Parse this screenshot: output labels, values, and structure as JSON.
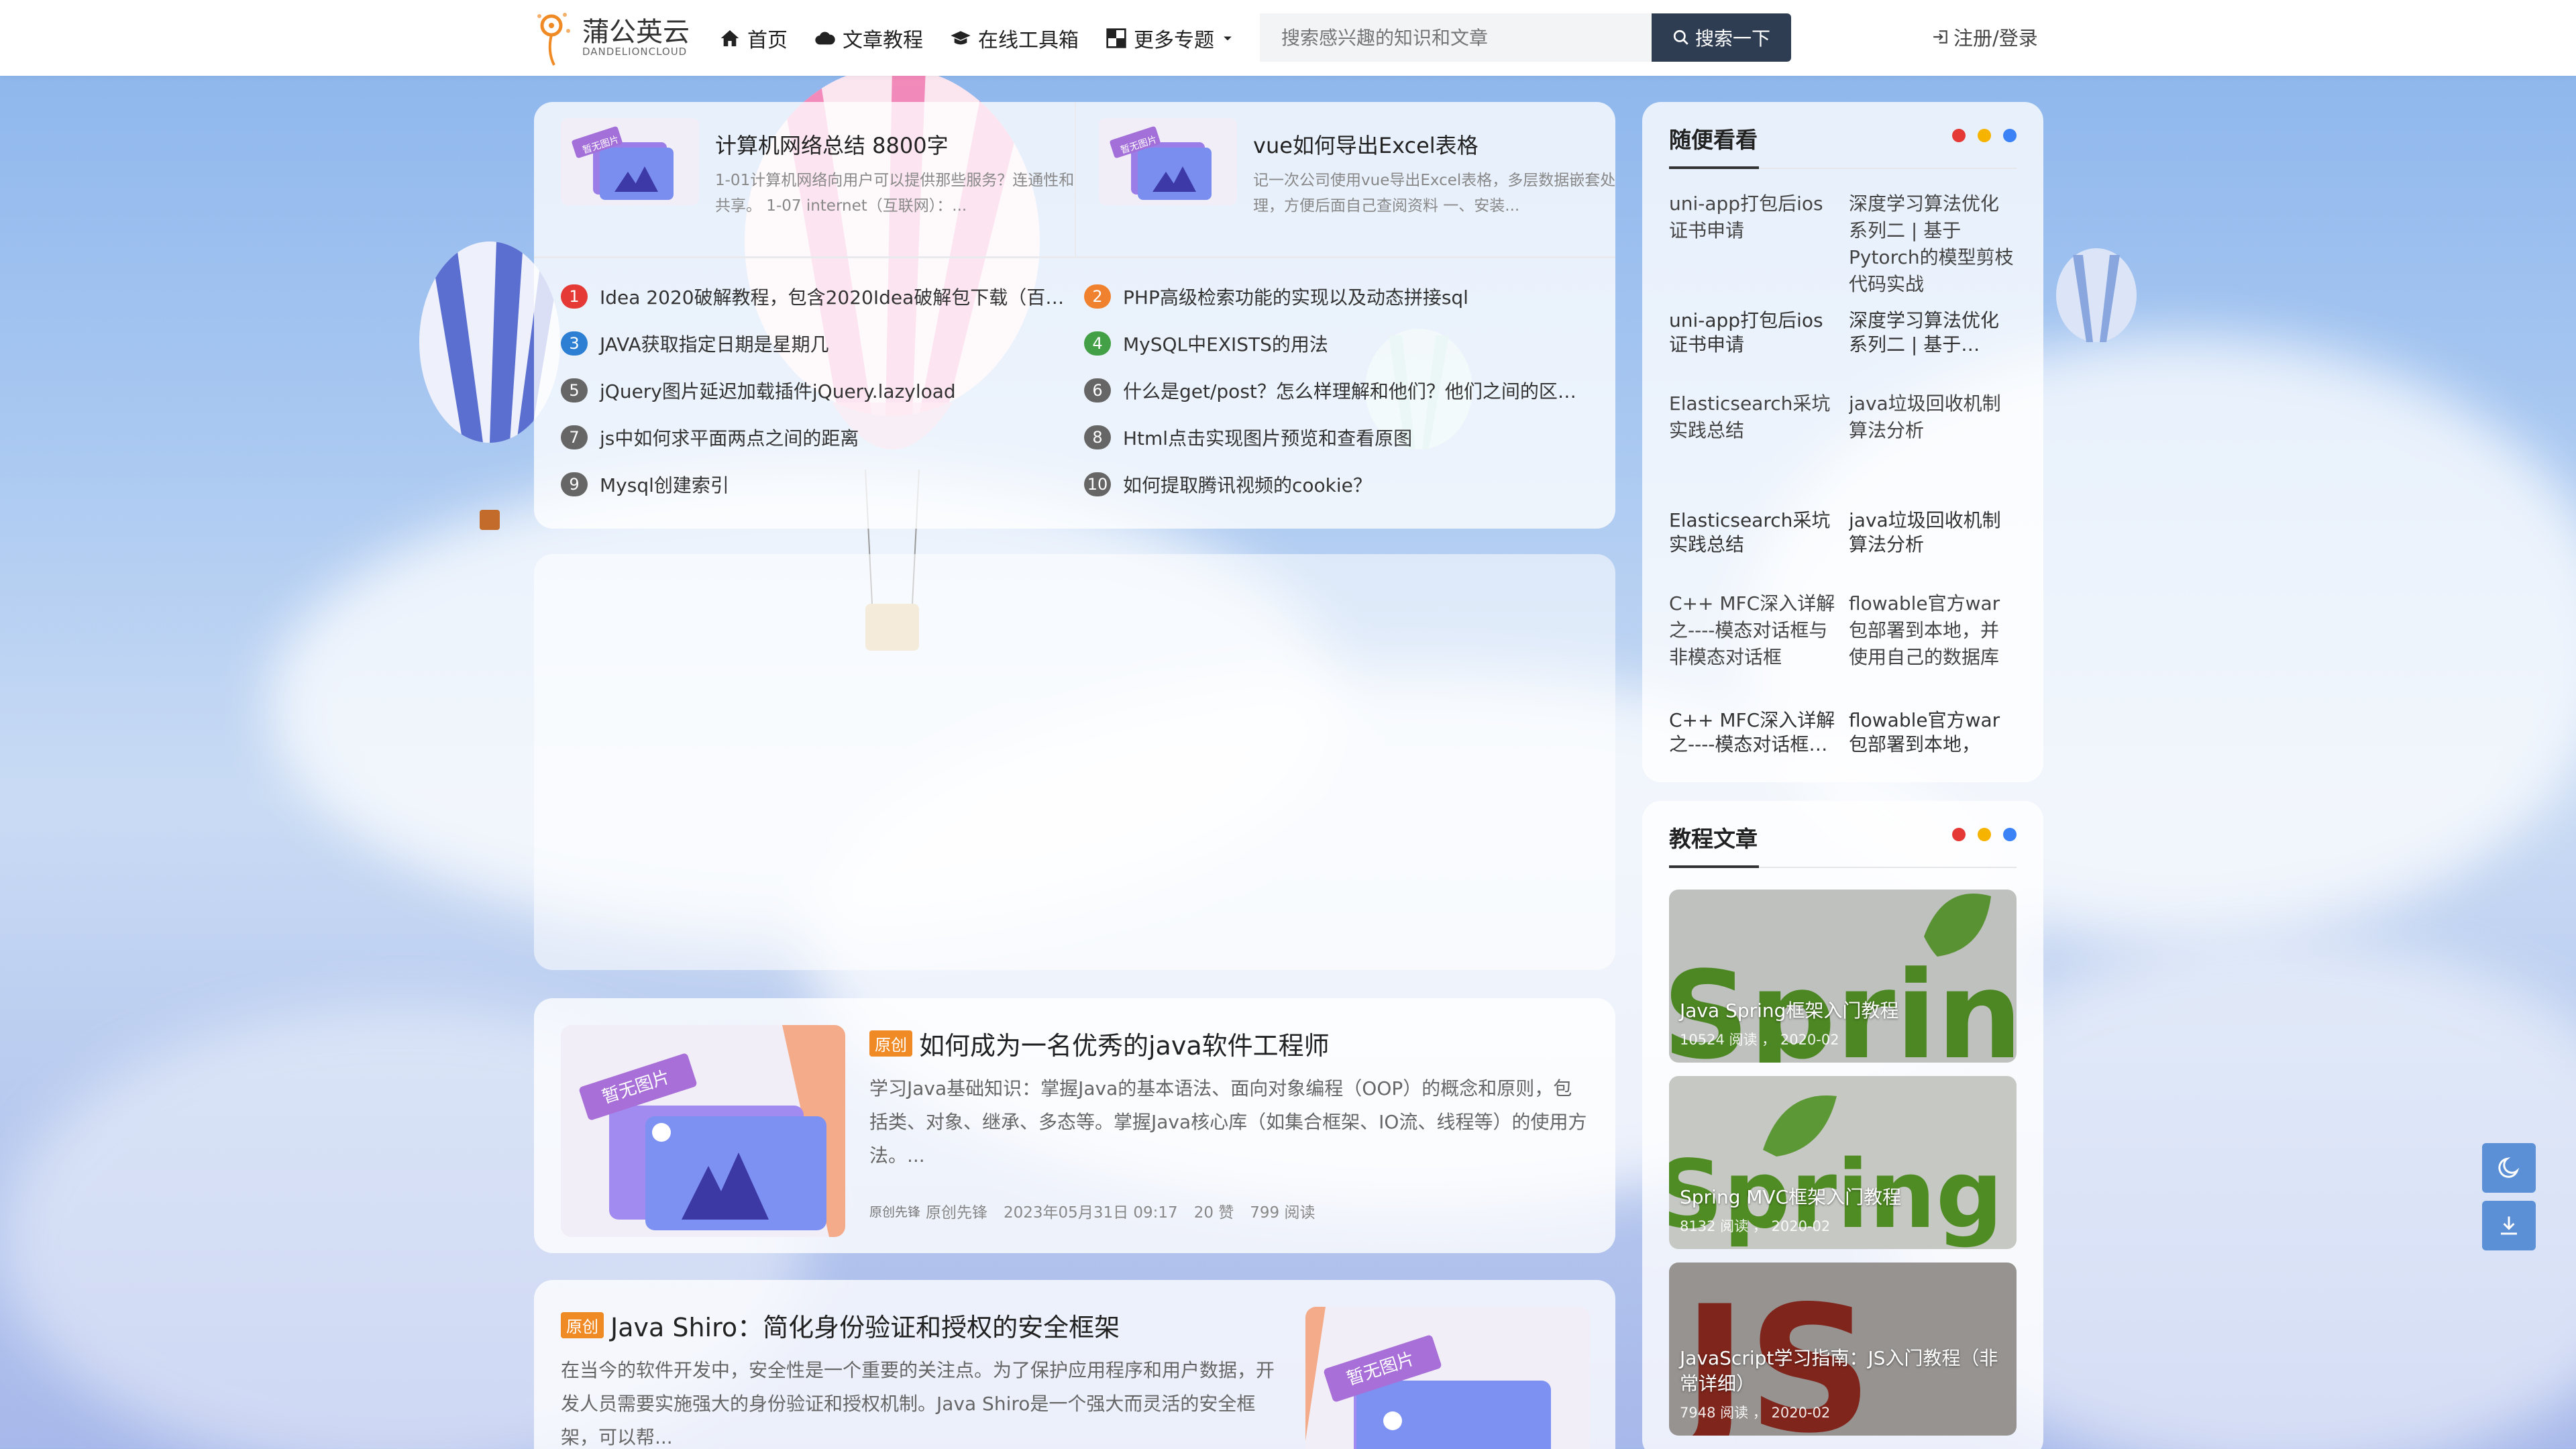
{
  "header": {
    "logo_text": "蒲公英云",
    "logo_sub": "DANDELIONCLOUD",
    "nav": [
      "首页",
      "文章教程",
      "在线工具箱",
      "更多专题"
    ],
    "search_placeholder": "搜索感兴趣的知识和文章",
    "search_button": "搜索一下",
    "login": "注册/登录"
  },
  "featured": [
    {
      "title": "计算机网络总结 8800字",
      "desc": "1-01计算机网络向用户可以提供那些服务？连通性和共享。 1-07 internet（互联网）：...",
      "thumb_label": "暂无图片"
    },
    {
      "title": "vue如何导出Excel表格",
      "desc": "记一次公司使用vue导出Excel表格，多层数据嵌套处理，方便后面自己查阅资料 一、安装...",
      "thumb_label": "暂无图片"
    }
  ],
  "ranking": [
    {
      "num": "1",
      "text": "Idea 2020破解教程，包含2020Idea破解包下载（百…"
    },
    {
      "num": "2",
      "text": "PHP高级检索功能的实现以及动态拼接sql"
    },
    {
      "num": "3",
      "text": "JAVA获取指定日期是星期几"
    },
    {
      "num": "4",
      "text": "MySQL中EXISTS的用法"
    },
    {
      "num": "5",
      "text": "jQuery图片延迟加载插件jQuery.lazyload"
    },
    {
      "num": "6",
      "text": "什么是get/post？怎么样理解和他们？他们之间的区…"
    },
    {
      "num": "7",
      "text": "js中如何求平面两点之间的距离"
    },
    {
      "num": "8",
      "text": "Html点击实现图片预览和查看原图"
    },
    {
      "num": "9",
      "text": "Mysql创建索引"
    },
    {
      "num": "10",
      "text": "如何提取腾讯视频的cookie？"
    }
  ],
  "articles": [
    {
      "tag": "原创",
      "title": "如何成为一名优秀的java软件工程师",
      "body": "学习Java基础知识：掌握Java的基本语法、面向对象编程（OOP）的概念和原则，包括类、对象、继承、多态等。掌握Java核心库（如集合框架、IO流、线程等）的使用方法。...",
      "author": "原创先锋",
      "author_alt": "原创先锋",
      "date": "2023年05月31日 09:17",
      "likes": "20 赞",
      "reads": "799 阅读",
      "thumb_label": "暂无图片"
    },
    {
      "tag": "原创",
      "title": "Java Shiro：简化身份验证和授权的安全框架",
      "body": "在当今的软件开发中，安全性是一个重要的关注点。为了保护应用程序和用户数据，开发人员需要实施强大的身份验证和授权机制。Java Shiro是一个强大而灵活的安全框架，可以帮...",
      "thumb_label": "暂无图片"
    }
  ],
  "sidebar": {
    "random_title": "随便看看",
    "random": [
      {
        "alt": "uni-app打包后ios证书申请",
        "caption": "uni-app打包后ios证书申请"
      },
      {
        "alt": "深度学习算法优化系列二 | 基于Pytorch的模型剪枝代码实战",
        "caption": "深度学习算法优化系列二 | 基于…"
      },
      {
        "alt": "Elasticsearch采坑实践总结",
        "caption": "Elasticsearch采坑实践总结"
      },
      {
        "alt": "java垃圾回收机制算法分析",
        "caption": "java垃圾回收机制算法分析"
      },
      {
        "alt": "C++ MFC深入详解之----模态对话框与非模态对话框",
        "caption": "C++ MFC深入详解之----模态对话框…"
      },
      {
        "alt": "flowable官方war包部署到本地，并使用自己的数据库",
        "caption": "flowable官方war包部署到本地，并…"
      }
    ],
    "tutorial_title": "教程文章",
    "tutorials": [
      {
        "title": "Java Spring框架入门教程",
        "reads": "10524 阅读",
        "date": "2020-02",
        "bg": "spring"
      },
      {
        "title": "Spring MVC框架入门教程",
        "reads": "8132 阅读",
        "date": "2020-02",
        "bg": "springmvc"
      },
      {
        "title": "JavaScript学习指南：JS入门教程（非常详细）",
        "reads": "7948 阅读",
        "date": "2020-02",
        "bg": "js"
      }
    ]
  },
  "colors": {
    "accent": "#2f3d52",
    "rank_colors": [
      "#e53935",
      "#f0812f",
      "#2d7fd3",
      "#43a047",
      "#666666",
      "#666666",
      "#666666",
      "#666666",
      "#666666",
      "#666666"
    ],
    "dots": [
      "#e53935",
      "#f6b300",
      "#3b82f6"
    ],
    "tag": "#f08a24"
  },
  "float_buttons": [
    "moon-icon",
    "download-icon"
  ]
}
